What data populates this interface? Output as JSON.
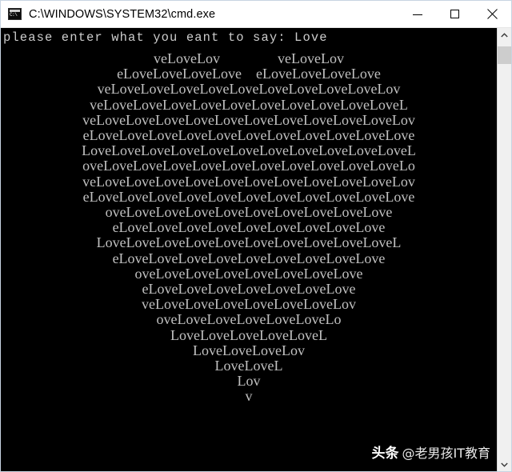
{
  "window": {
    "title": "C:\\WINDOWS\\SYSTEM32\\cmd.exe",
    "icon": "cmd-console-icon",
    "controls": {
      "minimize_label": "Minimize",
      "maximize_label": "Maximize",
      "close_label": "Close"
    }
  },
  "console": {
    "background_color": "#000000",
    "text_color": "#c0c0c0",
    "prompt_line": "please enter what you eant to say: Love",
    "input_word": "Love",
    "art_lines": [
      "veLoveLov                veLoveLov",
      "eLoveLoveLoveLove    eLoveLoveLoveLove",
      "veLoveLoveLoveLoveLoveLoveLoveLoveLoveLov",
      "veLoveLoveLoveLoveLoveLoveLoveLoveLoveLoveL",
      "veLoveLoveLoveLoveLoveLoveLoveLoveLoveLoveLov",
      "eLoveLoveLoveLoveLoveLoveLoveLoveLoveLoveLove",
      "LoveLoveLoveLoveLoveLoveLoveLoveLoveLoveLoveL",
      "oveLoveLoveLoveLoveLoveLoveLoveLoveLoveLoveLo",
      "veLoveLoveLoveLoveLoveLoveLoveLoveLoveLoveLov",
      "eLoveLoveLoveLoveLoveLoveLoveLoveLoveLoveLove",
      "oveLoveLoveLoveLoveLoveLoveLoveLoveLove",
      "eLoveLoveLoveLoveLoveLoveLoveLoveLove",
      "LoveLoveLoveLoveLoveLoveLoveLoveLoveLoveL",
      "eLoveLoveLoveLoveLoveLoveLoveLoveLove",
      "oveLoveLoveLoveLoveLoveLoveLove",
      "eLoveLoveLoveLoveLoveLoveLove",
      "veLoveLoveLoveLoveLoveLoveLov",
      "oveLoveLoveLoveLoveLoveLo",
      "LoveLoveLoveLoveLoveL",
      "LoveLoveLoveLov",
      "LoveLoveL",
      "Lov",
      "v"
    ]
  },
  "scrollbar": {
    "up_arrow": "chevron-up-icon",
    "down_arrow": "chevron-down-icon",
    "thumb": "scrollbar-thumb"
  },
  "watermark": {
    "brand": "头条",
    "handle": "@老男孩IT教育"
  }
}
